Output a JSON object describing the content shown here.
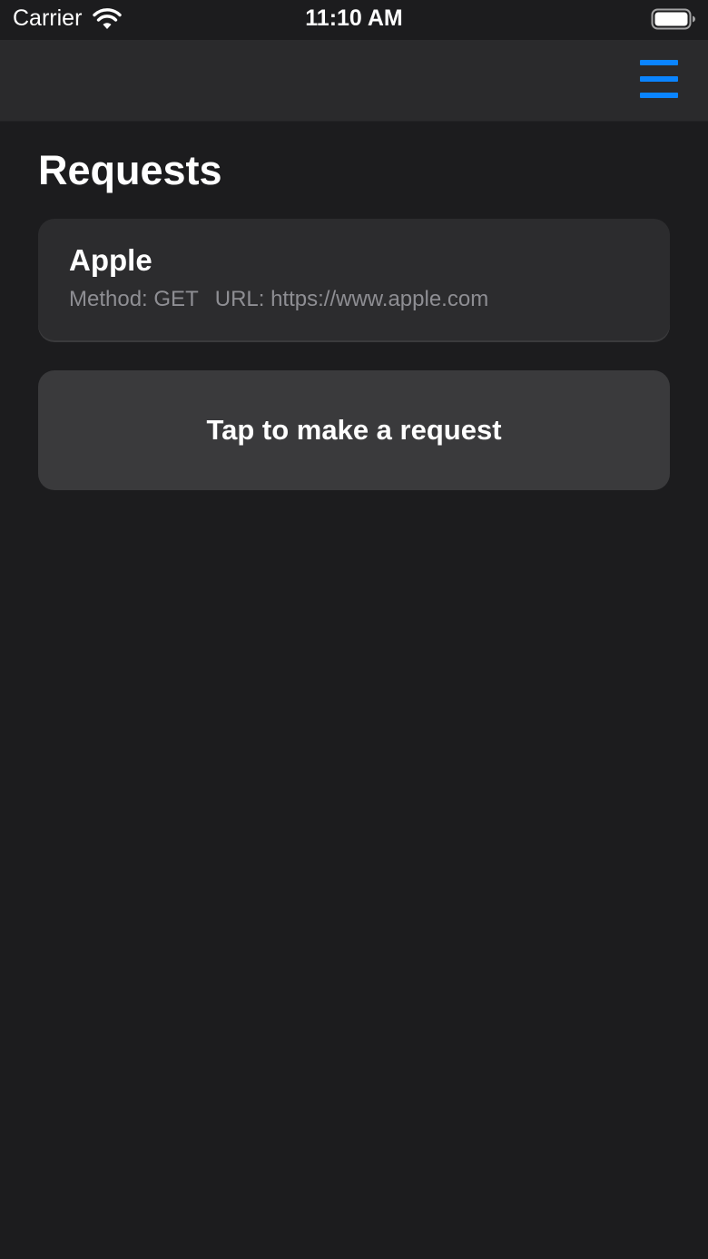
{
  "status_bar": {
    "carrier": "Carrier",
    "time": "11:10 AM",
    "wifi_icon": "wifi-icon",
    "battery_icon": "battery-icon"
  },
  "nav_bar": {
    "menu_icon": "hamburger-menu-icon",
    "accent_color": "#0a84ff"
  },
  "page": {
    "title": "Requests"
  },
  "requests": [
    {
      "name": "Apple",
      "method_text": "Method: GET",
      "url_text": "URL: https://www.apple.com"
    }
  ],
  "actions": {
    "make_request_label": "Tap to make a request"
  },
  "colors": {
    "background": "#1c1c1e",
    "nav_background": "#2a2a2c",
    "card_background": "#2c2c2e",
    "button_background": "#3a3a3c",
    "secondary_text": "#8e8e93"
  }
}
